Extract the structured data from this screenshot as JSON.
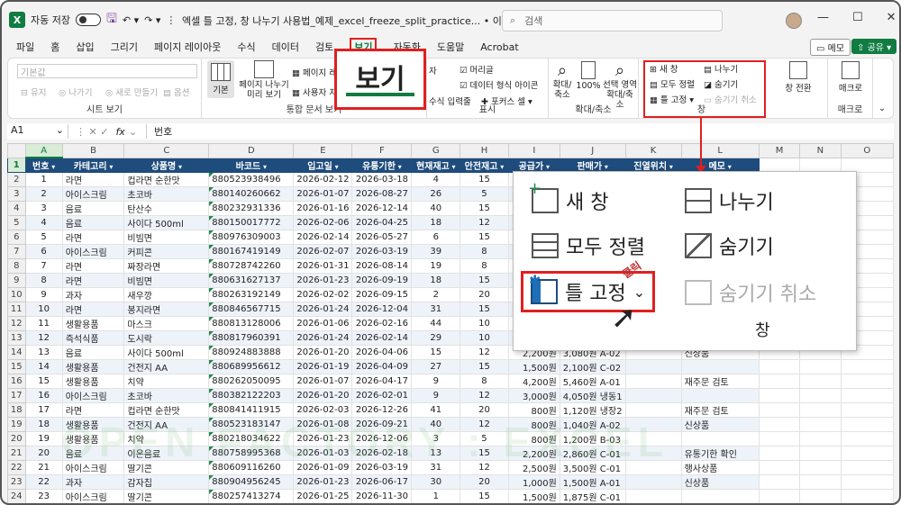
{
  "titlebar": {
    "logo": "X",
    "autosave_label": "자동 저장",
    "autosave_state": "끔",
    "title": "엑셀 틀 고정, 창 나누기 사용법_예제_excel_freeze_split_practice... • 이 PC에 저장됨",
    "search_placeholder": "검색",
    "window_buttons": [
      "—",
      "☐",
      "✕"
    ]
  },
  "menu": {
    "items": [
      "파일",
      "홈",
      "삽입",
      "그리기",
      "페이지 레이아웃",
      "수식",
      "데이터",
      "검토",
      "보기",
      "자동화",
      "도움말",
      "Acrobat"
    ],
    "active": "보기",
    "memo_label": "메모",
    "share_label": "공유"
  },
  "ribbon": {
    "sheet_view": {
      "selector": "기본값",
      "keep": "유지",
      "exit": "나가기",
      "new": "새로 만들기",
      "options": "옵션",
      "label": "시트 보기"
    },
    "workbook_view": {
      "normal": "기본",
      "page_break": "페이지 나누기 미리 보기",
      "page_layout": "페이지 레이",
      "custom": "사용자 지정",
      "label": "통합 문서 보기"
    },
    "show": {
      "ruler": "자",
      "gridlines": "눈금선",
      "formula_bar": "수식 입력줄",
      "headings": "머리글",
      "data_format": "데이터 형식 아이콘",
      "focus_cell": "포커스 셀",
      "label": "표시"
    },
    "zoom": {
      "zoom": "확대/축소",
      "hundred": "100%",
      "selection": "선택 영역 확대/축소",
      "label": "확대/축소"
    },
    "window": {
      "new_window": "새 창",
      "arrange_all": "모두 정렬",
      "freeze_panes": "틀 고정",
      "split": "나누기",
      "hide": "숨기기",
      "unhide": "숨기기 취소",
      "label": "창"
    },
    "switch_window": "창 전환",
    "macros": "매크로",
    "macros_label": "매크로"
  },
  "formula_bar": {
    "name_box": "A1",
    "fx": "fx",
    "value": "번호"
  },
  "grid": {
    "columns": [
      "A",
      "B",
      "C",
      "D",
      "E",
      "F",
      "G",
      "H",
      "I",
      "J",
      "K",
      "L",
      "M",
      "N",
      "O"
    ],
    "headers": [
      "번호",
      "카테고리",
      "상품명",
      "바코드",
      "입고일",
      "유통기한",
      "현재재고",
      "안전재고",
      "공급가",
      "판매가",
      "진열위치",
      "메모"
    ],
    "rows": [
      [
        "1",
        "라면",
        "컵라면 순한맛",
        "880523938496",
        "2026-02-12",
        "2026-03-18",
        "4",
        "15",
        "",
        "",
        "",
        ""
      ],
      [
        "2",
        "아이스크림",
        "초코바",
        "880140260662",
        "2026-01-07",
        "2026-08-27",
        "26",
        "5",
        "",
        "",
        "",
        ""
      ],
      [
        "3",
        "음료",
        "탄산수",
        "880232931336",
        "2026-01-16",
        "2026-12-14",
        "40",
        "15",
        "",
        "",
        "",
        ""
      ],
      [
        "4",
        "음료",
        "사이다 500ml",
        "880150017772",
        "2026-02-06",
        "2026-04-25",
        "18",
        "12",
        "",
        "",
        "",
        ""
      ],
      [
        "5",
        "라면",
        "비빔면",
        "880976309003",
        "2026-02-14",
        "2026-05-27",
        "6",
        "15",
        "",
        "",
        "",
        ""
      ],
      [
        "6",
        "아이스크림",
        "커피콘",
        "880167419149",
        "2026-02-07",
        "2026-03-19",
        "39",
        "8",
        "",
        "",
        "",
        ""
      ],
      [
        "7",
        "라면",
        "짜장라면",
        "880728742260",
        "2026-01-31",
        "2026-08-14",
        "19",
        "8",
        "",
        "",
        "",
        ""
      ],
      [
        "8",
        "라면",
        "비빔면",
        "880631627137",
        "2026-01-23",
        "2026-09-19",
        "18",
        "15",
        "",
        "",
        "",
        ""
      ],
      [
        "9",
        "과자",
        "새우깡",
        "880263192149",
        "2026-02-02",
        "2026-09-15",
        "2",
        "20",
        "",
        "",
        "",
        ""
      ],
      [
        "10",
        "라면",
        "봉지라면",
        "880846567715",
        "2026-01-24",
        "2026-12-04",
        "31",
        "15",
        "",
        "",
        "",
        ""
      ],
      [
        "11",
        "생활용품",
        "마스크",
        "880813128006",
        "2026-01-06",
        "2026-02-16",
        "44",
        "10",
        "",
        "",
        "",
        ""
      ],
      [
        "12",
        "즉석식품",
        "도시락",
        "880817960391",
        "2026-01-24",
        "2026-02-14",
        "29",
        "10",
        "",
        "",
        "",
        ""
      ],
      [
        "13",
        "음료",
        "사이다 500ml",
        "880924883888",
        "2026-01-20",
        "2026-04-06",
        "15",
        "12",
        "2,200원",
        "3,080원 A-02",
        "",
        "신상품"
      ],
      [
        "14",
        "생활용품",
        "건전지 AA",
        "880689956612",
        "2026-01-19",
        "2026-04-09",
        "27",
        "15",
        "1,500원",
        "2,100원 C-02",
        "",
        ""
      ],
      [
        "15",
        "생활용품",
        "치약",
        "880262050095",
        "2026-01-07",
        "2026-04-17",
        "9",
        "8",
        "4,200원",
        "5,460원 A-01",
        "",
        "재주문 검토"
      ],
      [
        "16",
        "아이스크림",
        "초코바",
        "880382122203",
        "2026-01-20",
        "2026-02-01",
        "9",
        "12",
        "3,000원",
        "4,050원 냉동1",
        "",
        ""
      ],
      [
        "17",
        "라면",
        "컵라면 순한맛",
        "880841411915",
        "2026-02-03",
        "2026-12-26",
        "41",
        "20",
        "800원",
        "1,120원 냉장2",
        "",
        "재주문 검토"
      ],
      [
        "18",
        "생활용품",
        "건전지 AA",
        "880523183147",
        "2026-01-08",
        "2026-09-21",
        "40",
        "12",
        "800원",
        "1,040원 A-02",
        "",
        "신상품"
      ],
      [
        "19",
        "생활용품",
        "치약",
        "880218034622",
        "2026-01-23",
        "2026-12-06",
        "3",
        "5",
        "800원",
        "1,200원 B-03",
        "",
        ""
      ],
      [
        "20",
        "음료",
        "이온음료",
        "880758995368",
        "2026-01-03",
        "2026-02-18",
        "13",
        "15",
        "2,200원",
        "2,860원 C-01",
        "",
        "유통기한 확인"
      ],
      [
        "21",
        "아이스크림",
        "딸기콘",
        "880609116260",
        "2026-01-09",
        "2026-03-19",
        "31",
        "12",
        "2,500원",
        "3,500원 C-01",
        "",
        "행사상품"
      ],
      [
        "22",
        "과자",
        "감자칩",
        "880904956245",
        "2026-01-23",
        "2026-06-17",
        "30",
        "20",
        "1,000원",
        "1,500원 A-01",
        "",
        "신상품"
      ],
      [
        "23",
        "아이스크림",
        "딸기콘",
        "880257413274",
        "2026-01-25",
        "2026-11-30",
        "1",
        "15",
        "1,500원",
        "1,875원 C-01",
        "",
        ""
      ]
    ]
  },
  "watermark": "OPEN FACTORY : EXCEL",
  "callout": {
    "tab_label": "보기",
    "popup": {
      "new_window": "새 창",
      "arrange_all": "모두 정렬",
      "freeze_panes": "틀 고정",
      "split": "나누기",
      "hide": "숨기기",
      "unhide": "숨기기 취소",
      "group_label": "창",
      "click_note": "클릭"
    }
  },
  "colors": {
    "accent": "#107c41",
    "header_bg": "#1e4c7c",
    "highlight": "#e02020"
  }
}
